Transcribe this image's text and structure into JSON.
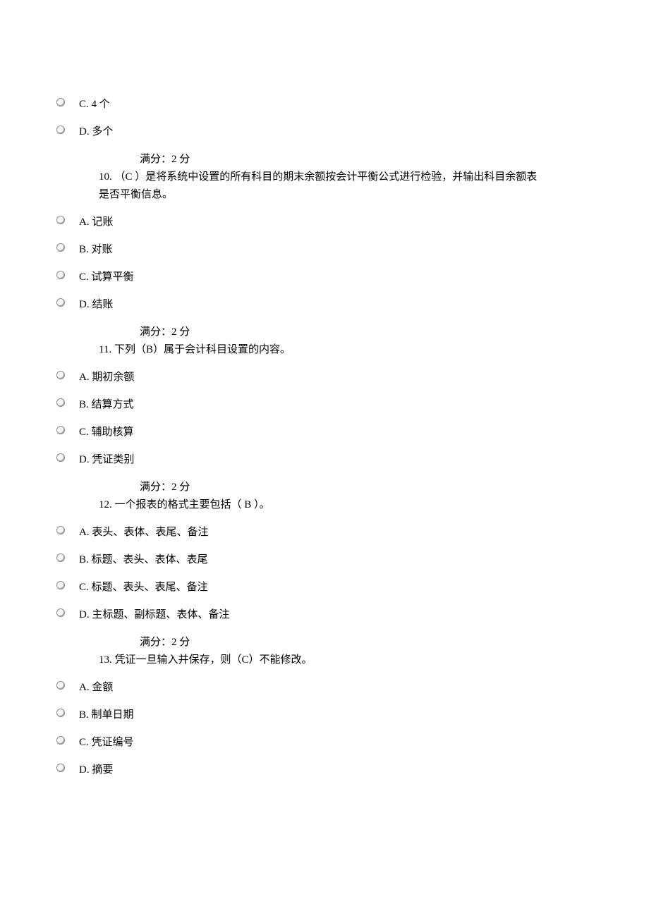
{
  "q9_tail": {
    "options": [
      "C. 4 个",
      "D. 多个"
    ]
  },
  "score_label": "满分：2    分",
  "q10": {
    "number_text": "10.  （C ）是将系统中设置的所有科目的期末余额按会计平衡公式进行检验，并输出科目余额表",
    "continue_text": "是否平衡信息。",
    "options": [
      "A. 记账",
      "B. 对账",
      "C. 试算平衡",
      "D. 结账"
    ]
  },
  "q11": {
    "number_text": "11.   下列（B）属于会计科目设置的内容。",
    "options": [
      "A. 期初余额",
      "B. 结算方式",
      "C. 辅助核算",
      "D. 凭证类别"
    ]
  },
  "q12": {
    "number_text": "12.   一个报表的格式主要包括（ B  ）。",
    "options": [
      "A. 表头、表体、表尾、备注",
      "B. 标题、表头、表体、表尾",
      "C. 标题、表头、表尾、备注",
      "D. 主标题、副标题、表体、备注"
    ]
  },
  "q13": {
    "number_text": "13.   凭证一旦输入并保存，则（C）不能修改。",
    "options": [
      "A. 金额",
      "B. 制单日期",
      "C. 凭证编号",
      "D. 摘要"
    ]
  }
}
